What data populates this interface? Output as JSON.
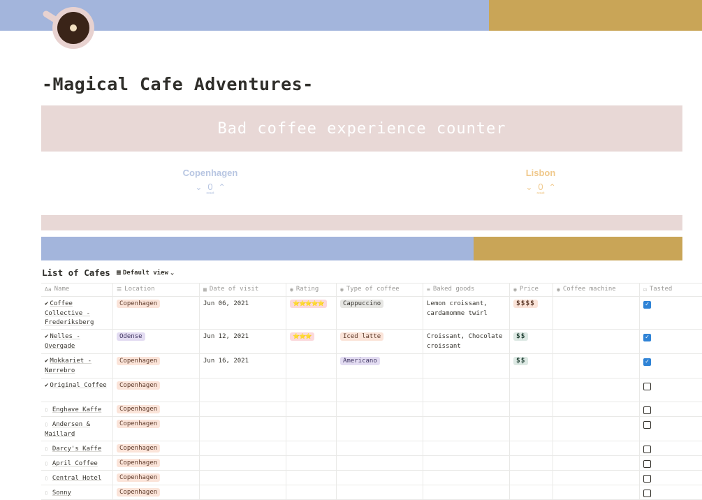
{
  "colors": {
    "banner_blue": "#a3b5dc",
    "banner_gold": "#c9a557",
    "counter_bg": "#e8d8d6"
  },
  "page": {
    "title": "-Magical Cafe Adventures-",
    "icon": "coffee-cup-icon"
  },
  "counter": {
    "title": "Bad coffee experience counter",
    "cities": [
      {
        "name": "Copenhagen",
        "value": "0",
        "reset": "reset"
      },
      {
        "name": "Lisbon",
        "value": "0",
        "reset": "reset"
      }
    ]
  },
  "database": {
    "title": "List of Cafes",
    "view": "Default view",
    "columns": [
      "Name",
      "Location",
      "Date of visit",
      "Rating",
      "Type of coffee",
      "Baked goods",
      "Price",
      "Coffee machine",
      "Tasted"
    ],
    "rows": [
      {
        "name": "Coffee Collective - Frederiksberg",
        "done": true,
        "location": "Copenhagen",
        "date": "Jun 06, 2021",
        "rating": "⭐⭐⭐⭐⭐",
        "coffee": "Cappuccino",
        "baked": "Lemon croissant, cardamomme twirl",
        "price": "$$$$",
        "machine": "",
        "tasted": true
      },
      {
        "name": "Nelles - Overgade",
        "done": true,
        "location": "Odense",
        "date": "Jun 12, 2021",
        "rating": "⭐⭐⭐",
        "coffee": "Iced latte",
        "baked": "Croissant, Chocolate croissant",
        "price": "$$",
        "machine": "",
        "tasted": true
      },
      {
        "name": "Mokkariet - Nørrebro",
        "done": true,
        "location": "Copenhagen",
        "date": "Jun 16, 2021",
        "rating": "",
        "coffee": "Americano",
        "baked": "",
        "price": "$$",
        "machine": "",
        "tasted": true
      },
      {
        "name": "Original Coffee",
        "done": true,
        "location": "Copenhagen",
        "date": "",
        "rating": "",
        "coffee": "",
        "baked": "",
        "price": "",
        "machine": "",
        "tasted": false
      },
      {
        "name": "Enghave Kaffe",
        "done": false,
        "location": "Copenhagen",
        "date": "",
        "rating": "",
        "coffee": "",
        "baked": "",
        "price": "",
        "machine": "",
        "tasted": false
      },
      {
        "name": "Andersen & Maillard",
        "done": false,
        "location": "Copenhagen",
        "date": "",
        "rating": "",
        "coffee": "",
        "baked": "",
        "price": "",
        "machine": "",
        "tasted": false
      },
      {
        "name": "Darcy's Kaffe",
        "done": false,
        "location": "Copenhagen",
        "date": "",
        "rating": "",
        "coffee": "",
        "baked": "",
        "price": "",
        "machine": "",
        "tasted": false
      },
      {
        "name": "April Coffee",
        "done": false,
        "location": "Copenhagen",
        "date": "",
        "rating": "",
        "coffee": "",
        "baked": "",
        "price": "",
        "machine": "",
        "tasted": false
      },
      {
        "name": "Central Hotel",
        "done": false,
        "location": "Copenhagen",
        "date": "",
        "rating": "",
        "coffee": "",
        "baked": "",
        "price": "",
        "machine": "",
        "tasted": false
      },
      {
        "name": "Sonny",
        "done": false,
        "location": "Copenhagen",
        "date": "",
        "rating": "",
        "coffee": "",
        "baked": "",
        "price": "",
        "machine": "",
        "tasted": false
      }
    ]
  }
}
